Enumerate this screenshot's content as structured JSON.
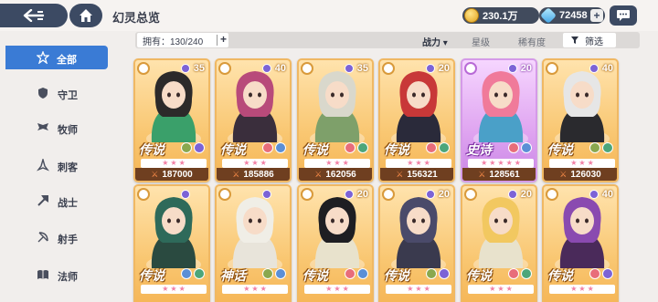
{
  "header": {
    "title": "幻灵总览",
    "gold": "230.1万",
    "gems": "72458",
    "plus_label": "+"
  },
  "sidebar": {
    "items": [
      {
        "label": "全部",
        "icon": "all-star-icon",
        "active": true
      },
      {
        "label": "守卫",
        "icon": "shield-icon",
        "active": false
      },
      {
        "label": "牧师",
        "icon": "wing-icon",
        "active": false
      },
      {
        "label": "刺客",
        "icon": "dagger-icon",
        "active": false
      },
      {
        "label": "战士",
        "icon": "axe-icon",
        "active": false
      },
      {
        "label": "射手",
        "icon": "bow-icon",
        "active": false
      },
      {
        "label": "法师",
        "icon": "book-icon",
        "active": false
      }
    ]
  },
  "toolbar": {
    "owned_label": "拥有：130/240",
    "sort_power": "战力",
    "sort_star": "星级",
    "sort_rarity": "稀有度",
    "filter_label": "筛选"
  },
  "cards": [
    {
      "level": "35",
      "rarity": "传说",
      "power": "187000",
      "stars": 0,
      "tier": "legend",
      "hair": "#2c2a2a",
      "outfit": "#3aa06a",
      "el1": "#8aa84e",
      "el2": "#7c63d6"
    },
    {
      "level": "40",
      "rarity": "传说",
      "power": "185886",
      "stars": 0,
      "tier": "legend",
      "hair": "#b84a7a",
      "outfit": "#3a2e3c",
      "el1": "#e86d7a",
      "el2": "#5b8fd6"
    },
    {
      "level": "35",
      "rarity": "传说",
      "power": "162056",
      "stars": 0,
      "tier": "legend",
      "hair": "#d9d8cc",
      "outfit": "#7ea06a",
      "el1": "#e86d7a",
      "el2": "#4da67a"
    },
    {
      "level": "20",
      "rarity": "传说",
      "power": "156321",
      "stars": 0,
      "tier": "legend",
      "hair": "#c83838",
      "outfit": "#2a2a3a",
      "el1": "#e86d7a",
      "el2": "#4da67a"
    },
    {
      "level": "20",
      "rarity": "史诗",
      "power": "128561",
      "stars": 5,
      "tier": "epic",
      "hair": "#f07a9a",
      "outfit": "#4aa0c8",
      "el1": "#e86d7a",
      "el2": "#5b8fd6"
    },
    {
      "level": "40",
      "rarity": "传说",
      "power": "126030",
      "stars": 0,
      "tier": "legend",
      "hair": "#e6e6e6",
      "outfit": "#2a2a2e",
      "el1": "#8aa84e",
      "el2": "#4da67a"
    },
    {
      "level": "",
      "rarity": "传说",
      "power": "",
      "stars": 0,
      "tier": "legend",
      "hair": "#2e6a5a",
      "outfit": "#2a4a40",
      "el1": "#5b8fd6",
      "el2": "#4da67a"
    },
    {
      "level": "",
      "rarity": "神话",
      "power": "",
      "stars": 0,
      "tier": "legend",
      "hair": "#f0eee6",
      "outfit": "#e8e4da",
      "el1": "#8aa84e",
      "el2": "#5b8fd6"
    },
    {
      "level": "20",
      "rarity": "传说",
      "power": "",
      "stars": 0,
      "tier": "legend",
      "hair": "#1e1e22",
      "outfit": "#e8e2cc",
      "el1": "#e86d7a",
      "el2": "#5b8fd6"
    },
    {
      "level": "20",
      "rarity": "传说",
      "power": "",
      "stars": 0,
      "tier": "legend",
      "hair": "#4a4a6a",
      "outfit": "#3a3a4e",
      "el1": "#8aa84e",
      "el2": "#7c63d6"
    },
    {
      "level": "20",
      "rarity": "传说",
      "power": "",
      "stars": 0,
      "tier": "legend",
      "hair": "#f2c860",
      "outfit": "#e8e2cc",
      "el1": "#e86d7a",
      "el2": "#4da67a"
    },
    {
      "level": "40",
      "rarity": "传说",
      "power": "",
      "stars": 0,
      "tier": "legend",
      "hair": "#8a4ab0",
      "outfit": "#4a2a5a",
      "el1": "#e86d7a",
      "el2": "#7c63d6"
    }
  ],
  "colors": {
    "accent": "#3a7bd5",
    "header_dark": "#3c4a63",
    "legend_border": "#f0b863",
    "epic_border": "#d59ae8"
  }
}
